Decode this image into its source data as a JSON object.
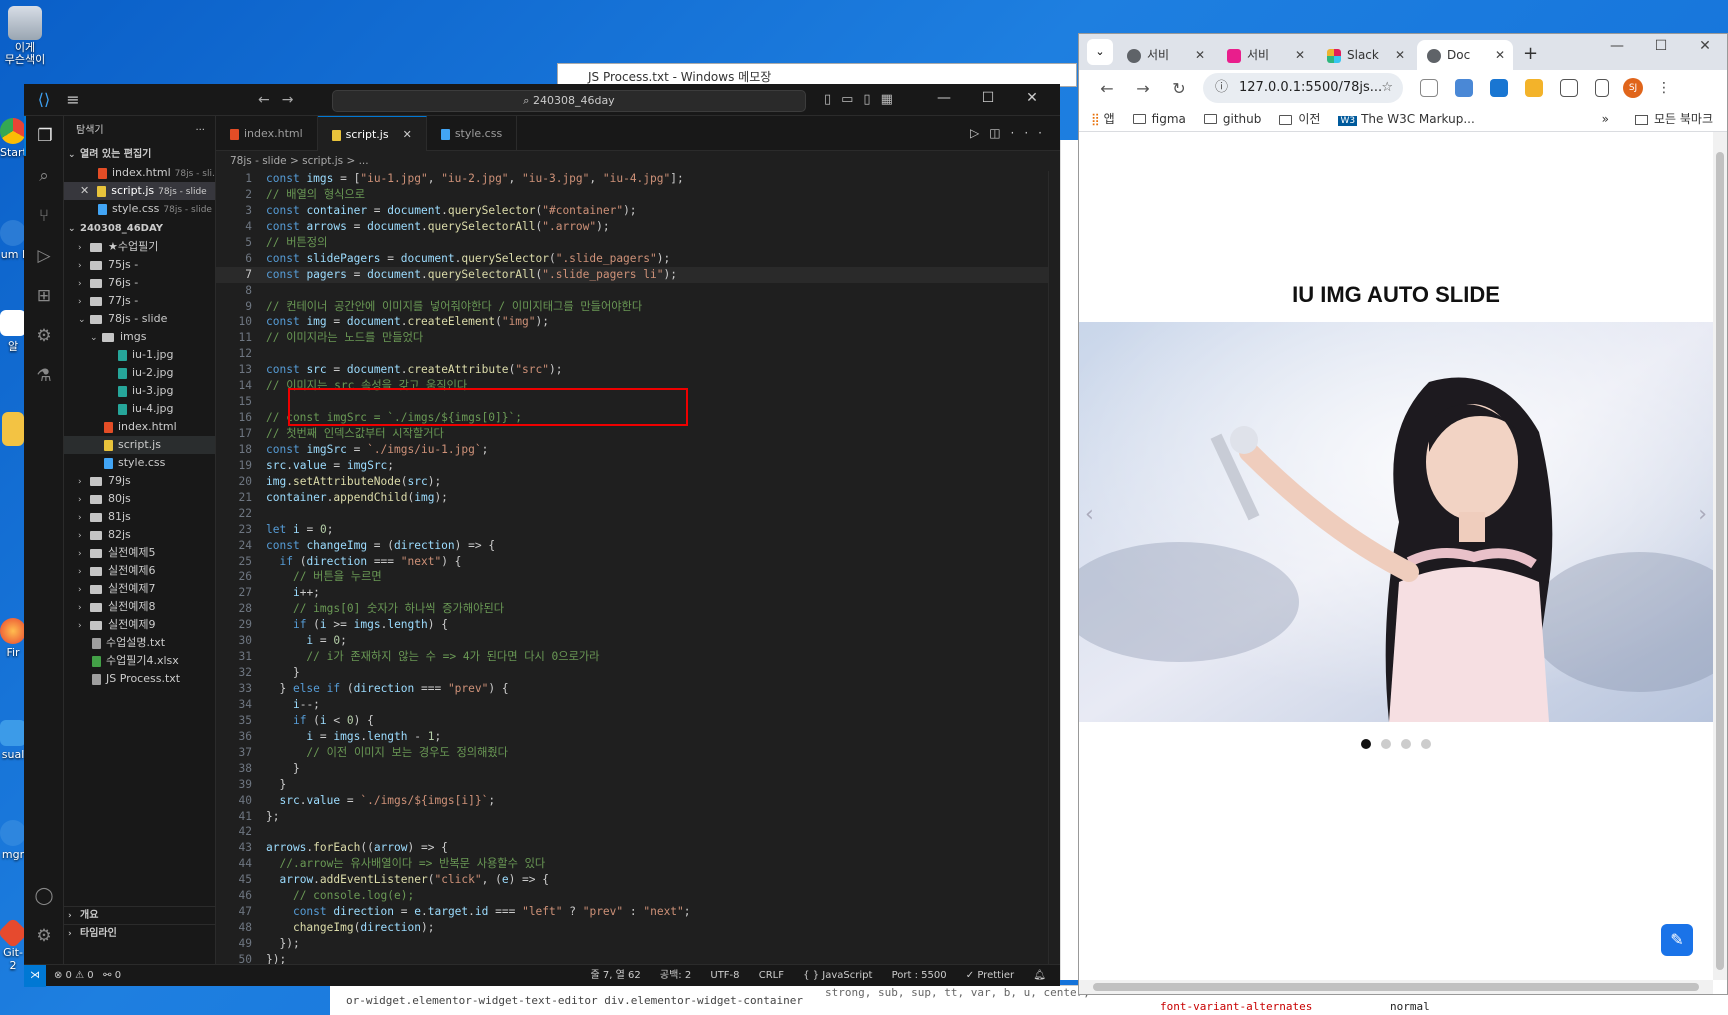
{
  "desktop": {
    "icons": [
      {
        "label": "이게\n무슨색이"
      },
      {
        "label": "Start"
      },
      {
        "label": "um I"
      },
      {
        "label": "알"
      },
      {
        "label": "Fir"
      },
      {
        "label": "sual"
      },
      {
        "label": "mgr"
      },
      {
        "label": "Git-2"
      }
    ]
  },
  "notepad": {
    "title": "JS Process.txt - Windows 메모장"
  },
  "vscode": {
    "search": "240308_46day",
    "explorer_title": "탐색기",
    "open_editors_label": "열려 있는 편집기",
    "open_editors": [
      {
        "name": "index.html",
        "meta": "78js - sli..."
      },
      {
        "name": "script.js",
        "meta": "78js - slide"
      },
      {
        "name": "style.css",
        "meta": "78js - slide"
      }
    ],
    "workspace_label": "240308_46DAY",
    "tree": [
      {
        "name": "★수업필기",
        "type": "folder",
        "depth": 1,
        "open": false
      },
      {
        "name": "75js -",
        "type": "folder",
        "depth": 1,
        "open": false
      },
      {
        "name": "76js -",
        "type": "folder",
        "depth": 1,
        "open": false
      },
      {
        "name": "77js -",
        "type": "folder",
        "depth": 1,
        "open": false
      },
      {
        "name": "78js - slide",
        "type": "folder",
        "depth": 1,
        "open": true
      },
      {
        "name": "imgs",
        "type": "folder",
        "depth": 2,
        "open": true
      },
      {
        "name": "iu-1.jpg",
        "type": "img",
        "depth": 3
      },
      {
        "name": "iu-2.jpg",
        "type": "img",
        "depth": 3
      },
      {
        "name": "iu-3.jpg",
        "type": "img",
        "depth": 3
      },
      {
        "name": "iu-4.jpg",
        "type": "img",
        "depth": 3
      },
      {
        "name": "index.html",
        "type": "html",
        "depth": 2
      },
      {
        "name": "script.js",
        "type": "js",
        "depth": 2
      },
      {
        "name": "style.css",
        "type": "css",
        "depth": 2
      },
      {
        "name": "79js",
        "type": "folder",
        "depth": 1,
        "open": false
      },
      {
        "name": "80js",
        "type": "folder",
        "depth": 1,
        "open": false
      },
      {
        "name": "81js",
        "type": "folder",
        "depth": 1,
        "open": false
      },
      {
        "name": "82js",
        "type": "folder",
        "depth": 1,
        "open": false
      },
      {
        "name": "실전예제5",
        "type": "folder",
        "depth": 1,
        "open": false
      },
      {
        "name": "실전예제6",
        "type": "folder",
        "depth": 1,
        "open": false
      },
      {
        "name": "실전예제7",
        "type": "folder",
        "depth": 1,
        "open": false
      },
      {
        "name": "실전예제8",
        "type": "folder",
        "depth": 1,
        "open": false
      },
      {
        "name": "실전예제9",
        "type": "folder",
        "depth": 1,
        "open": false
      },
      {
        "name": "수업설명.txt",
        "type": "txt",
        "depth": 1
      },
      {
        "name": "수업필기4.xlsx",
        "type": "xlsx",
        "depth": 1
      },
      {
        "name": "JS Process.txt",
        "type": "txt",
        "depth": 1
      }
    ],
    "outline_label": "개요",
    "timeline_label": "타임라인",
    "tabs": [
      {
        "label": "index.html",
        "active": false
      },
      {
        "label": "script.js",
        "active": true
      },
      {
        "label": "style.css",
        "active": false
      }
    ],
    "breadcrumb": "78js - slide  >  script.js  >  ...",
    "current_line": 7,
    "code": [
      "const imgs = [\"iu-1.jpg\", \"iu-2.jpg\", \"iu-3.jpg\", \"iu-4.jpg\"];",
      "// 배열의 형식으로",
      "const container = document.querySelector(\"#container\");",
      "const arrows = document.querySelectorAll(\".arrow\");",
      "// 버튼정의",
      "const slidePagers = document.querySelector(\".slide_pagers\");",
      "const pagers = document.querySelectorAll(\".slide_pagers li\");",
      "",
      "// 컨테이너 공간안에 이미지를 넣어줘야한다 / 이미지태그를 만들어야한다",
      "const img = document.createElement(\"img\");",
      "// 이미지라는 노드를 만들었다",
      "",
      "const src = document.createAttribute(\"src\");",
      "// 이미지는 src 속성을 갖고 움직인다",
      "",
      "// const imgSrc = `./imgs/${imgs[0]}`;",
      "// 첫번째 인덱스값부터 시작할거다",
      "const imgSrc = `./imgs/iu-1.jpg`;",
      "src.value = imgSrc;",
      "img.setAttributeNode(src);",
      "container.appendChild(img);",
      "",
      "let i = 0;",
      "const changeImg = (direction) => {",
      "  if (direction === \"next\") {",
      "    // 버튼을 누르면",
      "    i++;",
      "    // imgs[0] 숫자가 하나씩 증가해야된다",
      "    if (i >= imgs.length) {",
      "      i = 0;",
      "      // i가 존재하지 않는 수 => 4가 된다면 다시 0으로가라",
      "    }",
      "  } else if (direction === \"prev\") {",
      "    i--;",
      "    if (i < 0) {",
      "      i = imgs.length - 1;",
      "      // 이전 이미지 보는 경우도 정의해줬다",
      "    }",
      "  }",
      "  src.value = `./imgs/${imgs[i]}`;",
      "};",
      "",
      "arrows.forEach((arrow) => {",
      "  //.arrow는 유사배열이다 => 반복문 사용할수 있다",
      "  arrow.addEventListener(\"click\", (e) => {",
      "    // console.log(e);",
      "    const direction = e.target.id === \"left\" ? \"prev\" : \"next\";",
      "    changeImg(direction);",
      "  });",
      "});",
      ""
    ],
    "status": {
      "problems": "⊗ 0 ⚠ 0",
      "ports": "⚯ 0",
      "position": "줄 7, 열 62",
      "spaces": "공백: 2",
      "encoding": "UTF-8",
      "eol": "CRLF",
      "language": "{ } JavaScript",
      "port": "Port : 5500",
      "formatter": "✓ Prettier"
    }
  },
  "chrome": {
    "tabs": [
      {
        "label": "서비",
        "color": "#5f6368"
      },
      {
        "label": "서비",
        "color": "#e91e8c"
      },
      {
        "label": "Slack",
        "color": "#4a154b"
      },
      {
        "label": "Doc",
        "color": "#5f6368",
        "active": true
      }
    ],
    "url": "127.0.0.1:5500/78js...",
    "bookmarks": [
      "앱",
      "figma",
      "github",
      "이전",
      "The W3C Markup..."
    ],
    "bookmarks_right": "모든 북마크",
    "avatar": "SJ",
    "page_title": "IU IMG AUTO SLIDE",
    "active_slide": 0,
    "slide_count": 4
  },
  "devtools": {
    "left_text": "or-widget.elementor-widget-text-editor   div.elementor-widget-container",
    "middle_text": "strong, sub, sup, tt, var, b, u, center,",
    "prop": "font-variant-alternates",
    "value": "normal"
  }
}
